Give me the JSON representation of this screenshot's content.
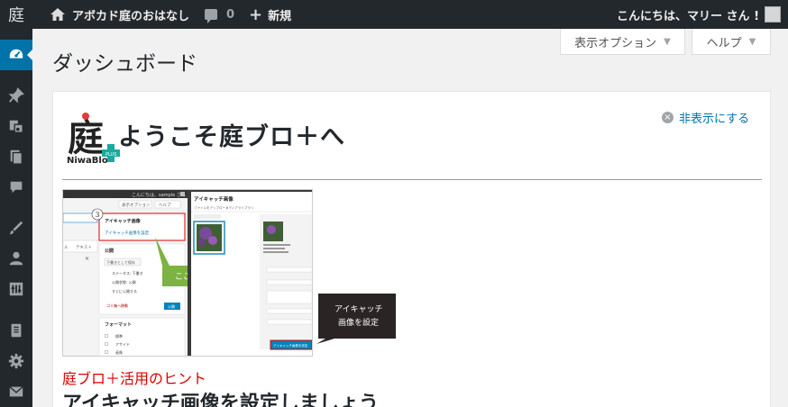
{
  "adminbar": {
    "logo_icon": "niwa-logo-icon",
    "site_name": "アボカド庭のおはなし",
    "comments_count": "0",
    "new_label": "新規",
    "greeting": "こんにちは、マリー さん !"
  },
  "sidebar": {
    "items": [
      {
        "icon": "dashboard-icon",
        "active": true
      },
      {
        "icon": "pin-icon"
      },
      {
        "icon": "media-icon"
      },
      {
        "icon": "pages-icon"
      },
      {
        "icon": "comments-icon"
      },
      {
        "icon": "appearance-icon"
      },
      {
        "icon": "users-icon"
      },
      {
        "icon": "tools-icon"
      },
      {
        "icon": "notebook-icon"
      },
      {
        "icon": "settings-icon"
      },
      {
        "icon": "mail-icon"
      }
    ]
  },
  "screen_options": {
    "options_label": "表示オプション",
    "help_label": "ヘルプ"
  },
  "page": {
    "title": "ダッシュボード"
  },
  "welcome": {
    "logo_text": "庭",
    "logo_caption": "NiwaBlo",
    "logo_badge": "PLUS",
    "title": "ようこそ庭ブロ＋へ",
    "dismiss_label": "非表示にする",
    "screenshot": {
      "header_greeting": "こんにちは、sample さん !",
      "options_label": "表示オプション",
      "help_label": "ヘルプ",
      "step_number": "3",
      "box_title": "アイキャッチ画像",
      "box_link": "アイキャッチ画像を設定",
      "callout_click": "ここをクリック",
      "publish_title": "公開",
      "save_draft": "下書きとして保存",
      "status": "ステータス: 下書き",
      "visibility": "公開状態: 公開",
      "schedule": "すぐに公開する",
      "trash": "ゴミ箱へ移動",
      "publish_btn": "公開",
      "format_title": "フォーマット",
      "formats": [
        "標準",
        "アサイド",
        "画像"
      ],
      "tab_visual": "ル",
      "tab_text": "テキスト",
      "modal_title": "アイキャッチ画像",
      "modal_tab_upload": "ファイルをアップロード",
      "modal_tab_library": "メディアライブラリ",
      "callout_set_line1": "アイキャッチ",
      "callout_set_line2": "画像を設定",
      "set_button": "アイキャッチ画像を設定"
    },
    "hint_label": "庭ブロ＋活用のヒント",
    "hint_title": "アイキャッチ画像を設定しましょう"
  },
  "colors": {
    "adminbar": "#23282d",
    "active": "#0073aa",
    "link": "#0073aa",
    "hint_red": "#dd0000",
    "callout_green": "#7cb342",
    "callout_dark": "#2b2424"
  }
}
